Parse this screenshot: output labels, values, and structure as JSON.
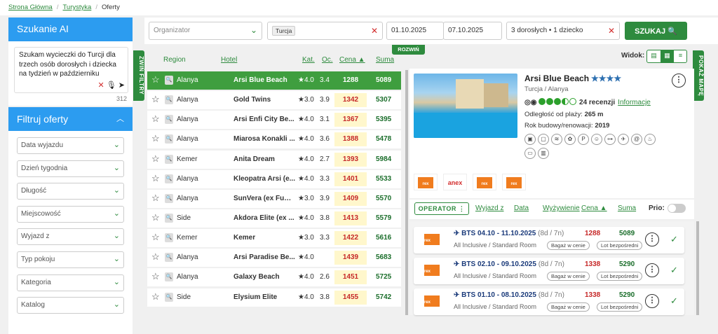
{
  "breadcrumb": {
    "home": "Strona Główna",
    "section": "Turystyka",
    "current": "Oferty"
  },
  "ai": {
    "title": "Szukanie AI",
    "query": "Szukam wycieczki do Turcji dla trzech osób dorosłych i dziecka na tydzień w październiku",
    "count": "312"
  },
  "filters": {
    "title": "Filtruj oferty",
    "items": [
      "Data wyjazdu",
      "Dzień tygodnia",
      "Długość",
      "Miejscowość",
      "Wyjazd z",
      "Typ pokoju",
      "Kategoria",
      "Katalog"
    ]
  },
  "tabs": {
    "zwin": "ZWIŃ FILTRY",
    "mapa": "POKAŻ MAPĘ",
    "rozwin": "ROZWIŃ"
  },
  "search": {
    "organizer_placeholder": "Organizator",
    "country": "Turcja",
    "date_from": "01.10.2025",
    "date_to": "07.10.2025",
    "persons": "3 dorosłych • 1 dziecko",
    "button": "SZUKAJ"
  },
  "list_headers": {
    "region": "Region",
    "hotel": "Hotel",
    "kat": "Kat.",
    "oc": "Oc.",
    "cena": "Cena",
    "suma": "Suma"
  },
  "rows": [
    {
      "region": "Alanya",
      "hotel": "Arsi Blue Beach",
      "kat": "★4.0",
      "oc": "3.4",
      "price": "1288",
      "sum": "5089"
    },
    {
      "region": "Alanya",
      "hotel": "Gold Twins",
      "kat": "★3.0",
      "oc": "3.9",
      "price": "1342",
      "sum": "5307"
    },
    {
      "region": "Alanya",
      "hotel": "Arsi Enfi City Be...",
      "kat": "★4.0",
      "oc": "3.1",
      "price": "1367",
      "sum": "5395"
    },
    {
      "region": "Alanya",
      "hotel": "Miarosa Konakli ...",
      "kat": "★4.0",
      "oc": "3.6",
      "price": "1388",
      "sum": "5478"
    },
    {
      "region": "Kemer",
      "hotel": "Anita Dream",
      "kat": "★4.0",
      "oc": "2.7",
      "price": "1393",
      "sum": "5984"
    },
    {
      "region": "Alanya",
      "hotel": "Kleopatra Arsi (e...",
      "kat": "★4.0",
      "oc": "3.3",
      "price": "1401",
      "sum": "5533"
    },
    {
      "region": "Alanya",
      "hotel": "SunVera (ex Fun ...",
      "kat": "★3.0",
      "oc": "3.9",
      "price": "1409",
      "sum": "5570"
    },
    {
      "region": "Side",
      "hotel": "Akdora Elite (ex ...",
      "kat": "★4.0",
      "oc": "3.8",
      "price": "1413",
      "sum": "5579"
    },
    {
      "region": "Kemer",
      "hotel": "Kemer",
      "kat": "★3.0",
      "oc": "3.3",
      "price": "1422",
      "sum": "5616"
    },
    {
      "region": "Alanya",
      "hotel": "Arsi Paradise Be...",
      "kat": "★4.0",
      "oc": "",
      "price": "1439",
      "sum": "5683"
    },
    {
      "region": "Alanya",
      "hotel": "Galaxy Beach",
      "kat": "★4.0",
      "oc": "2.6",
      "price": "1451",
      "sum": "5725"
    },
    {
      "region": "Side",
      "hotel": "Elysium Elite",
      "kat": "★4.0",
      "oc": "3.8",
      "price": "1455",
      "sum": "5742"
    }
  ],
  "view": {
    "label": "Widok:"
  },
  "hotel": {
    "name": "Arsi Blue Beach",
    "stars": "★★★★",
    "location": "Turcja / Alanya",
    "reviews": "24 recenzji",
    "info": "Informacje",
    "distance_label": "Odległość od plaży:",
    "distance": "265 m",
    "year_label": "Rok budowy/renowacji:",
    "year": "2019"
  },
  "operators": {
    "anex": "anex"
  },
  "offer_bar": {
    "operator": "OPERATOR",
    "wyjazd": "Wyjazd z",
    "data": "Data",
    "wyzywienie": "Wyżywienie",
    "cena": "Cena",
    "suma": "Suma",
    "prio": "Prio:"
  },
  "offers": [
    {
      "title": "BTS 04.10 - 11.10.2025",
      "nights": "(8d / 7n)",
      "sub": "All Inclusive / Standard Room",
      "price": "1288",
      "sum": "5089",
      "p1": "Bagaż w cenie",
      "p2": "Lot bezpośredni"
    },
    {
      "title": "BTS 02.10 - 09.10.2025",
      "nights": "(8d / 7n)",
      "sub": "All Inclusive / Standard Room",
      "price": "1338",
      "sum": "5290",
      "p1": "Bagaż w cenie",
      "p2": "Lot bezpośredni"
    },
    {
      "title": "BTS 01.10 - 08.10.2025",
      "nights": "(8d / 7n)",
      "sub": "All Inclusive / Standard Room",
      "price": "1338",
      "sum": "5290",
      "p1": "Bagaż w cenie",
      "p2": "Lot bezpośredni"
    }
  ],
  "colors": {
    "accent": "#2e8b3e",
    "blue": "#2c9cf0",
    "price": "#c62828"
  }
}
